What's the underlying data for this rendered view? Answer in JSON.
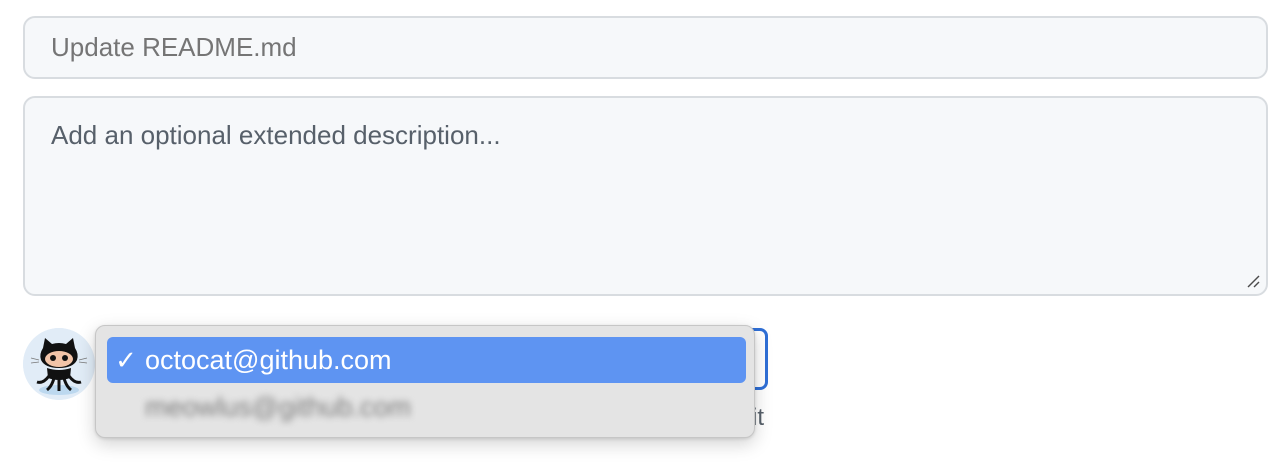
{
  "commit_form": {
    "summary": {
      "placeholder": "Update README.md"
    },
    "description": {
      "placeholder": "Add an optional extended description..."
    },
    "author_avatar": {
      "icon": "octocat-avatar"
    },
    "email_dropdown": {
      "options": [
        {
          "label": "octocat@github.com",
          "selected": true,
          "check": "✓"
        },
        {
          "label": "meowlus@github.com",
          "selected": false
        }
      ],
      "highlight_color": "#5e94f2",
      "focus_border_color": "#2f6fd6"
    },
    "obscured_text": "it"
  }
}
